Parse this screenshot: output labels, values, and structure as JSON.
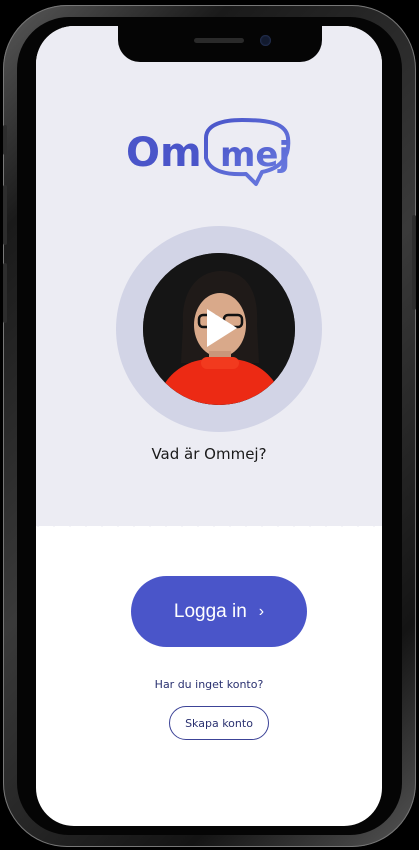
{
  "app": {
    "brand_logo": "Ommej",
    "brand_color": "#4a55c9",
    "background_top": "#ececf3"
  },
  "video": {
    "caption": "Vad är Ommej?",
    "icon": "play-icon"
  },
  "auth": {
    "login_label": "Logga in",
    "login_chevron": "›",
    "no_account_text": "Har du inget konto?",
    "create_account_label": "Skapa konto"
  }
}
